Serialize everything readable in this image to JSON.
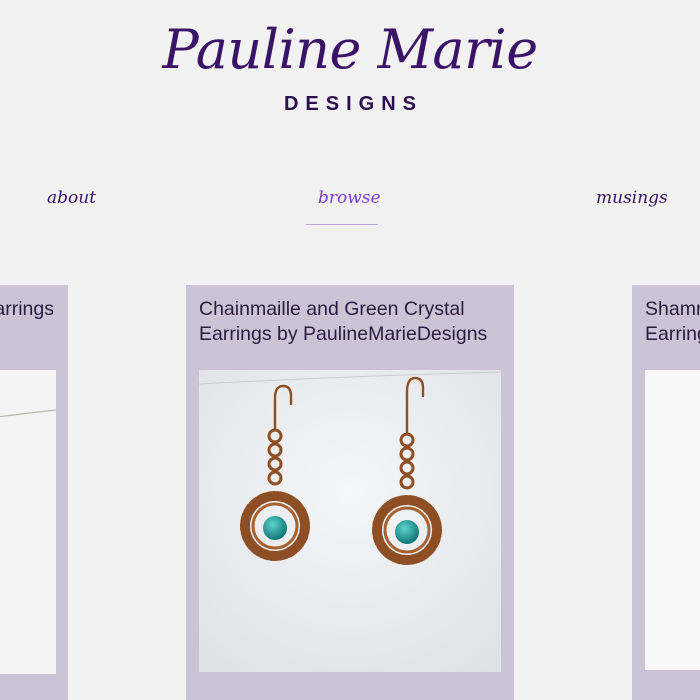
{
  "brand": {
    "name": "Pauline Marie",
    "subtitle": "DESIGNS"
  },
  "nav": {
    "items": [
      {
        "label": "about"
      },
      {
        "label": "browse"
      },
      {
        "label": "musings"
      }
    ],
    "active": "browse"
  },
  "products": [
    {
      "title_line1": "arrings"
    },
    {
      "title_line1": "Chainmaille and Green Crystal",
      "title_line2": "Earrings by PaulineMarieDesigns"
    },
    {
      "title_line1": "Shamr",
      "title_line2": "Earring"
    }
  ],
  "colors": {
    "background": "#f2f2f2",
    "brand_purple": "#3a1466",
    "active_nav": "#7a3fd1",
    "card_bg": "#cbc4d6",
    "copper": "#9a5a2c",
    "crystal": "#0f8a8a"
  },
  "icons": [
    "earrings-photo"
  ]
}
